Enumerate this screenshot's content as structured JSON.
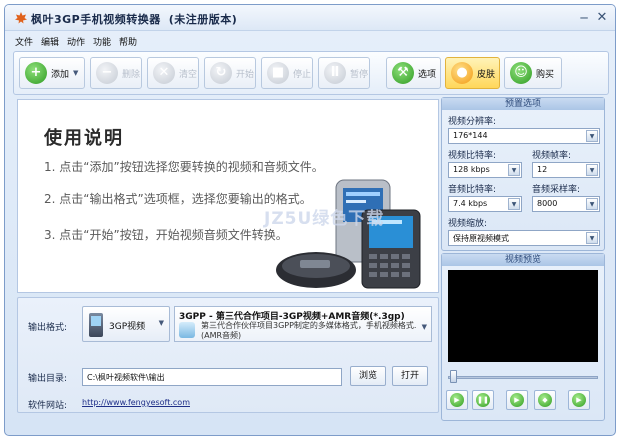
{
  "window": {
    "title": "枫叶3GP手机视频转换器",
    "title_note": "(未注册版本)"
  },
  "menu": [
    "文件",
    "编辑",
    "动作",
    "功能",
    "帮助"
  ],
  "toolbar": {
    "add": "添加",
    "delete": "删除",
    "clear": "清空",
    "start": "开始",
    "stop": "停止",
    "pause": "暂停",
    "options": "选项",
    "skin": "皮肤",
    "buy": "购买"
  },
  "instructions": {
    "title": "使用说明",
    "lines": [
      "1. 点击“添加”按钮选择您要转换的视频和音频文件。",
      "2. 点击“输出格式”选项框，选择您要输出的格式。",
      "3. 点击“开始”按钮，开始视频音频文件转换。"
    ],
    "watermark": "JZ5U绿色下载"
  },
  "output": {
    "format_label": "输出格式:",
    "format_value": "3GP视频",
    "format_desc_title": "3GPP - 第三代合作项目-3GP视频+AMR音频(*.3gp)",
    "format_desc_text": "第三代合作伙伴项目3GPP制定的多媒体格式，手机视频格式.(AMR音频)",
    "dir_label": "输出目录:",
    "dir_value": "C:\\枫叶视频软件\\输出",
    "browse": "浏览",
    "open": "打开",
    "website_label": "软件网站:",
    "website_url": "http://www.fengyesoft.com"
  },
  "preset": {
    "header": "预置选项",
    "resolution_label": "视频分辨率:",
    "resolution": "176*144",
    "video_bitrate_label": "视频比特率:",
    "video_bitrate": "128 kbps",
    "framerate_label": "视频帧率:",
    "framerate": "12",
    "audio_bitrate_label": "音频比特率:",
    "audio_bitrate": "7.4 kbps",
    "samplerate_label": "音频采样率:",
    "samplerate": "8000",
    "scale_label": "视频缩放:",
    "scale": "保持原视频模式"
  },
  "preview": {
    "header": "视频预览"
  }
}
